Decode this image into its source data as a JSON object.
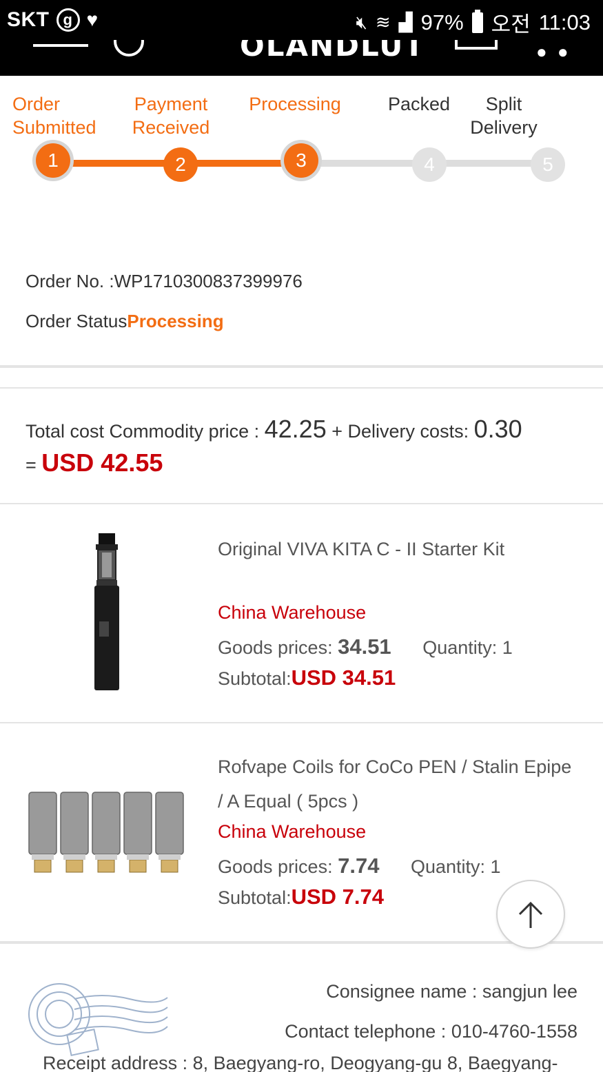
{
  "status_bar": {
    "carrier": "SKT",
    "carrier_badge": "g",
    "battery": "97%",
    "time_prefix": "오전",
    "time": "11:03"
  },
  "header": {
    "brand": "OLANDLUT"
  },
  "progress": {
    "steps": [
      {
        "label_line1": "Order",
        "label_line2": "Submitted",
        "number": "1",
        "state": "done"
      },
      {
        "label_line1": "Payment",
        "label_line2": "Received",
        "number": "2",
        "state": "done"
      },
      {
        "label_line1": "Processing",
        "label_line2": "",
        "number": "3",
        "state": "current"
      },
      {
        "label_line1": "Packed",
        "label_line2": "",
        "number": "4",
        "state": "todo"
      },
      {
        "label_line1": "Split",
        "label_line2": "Delivery",
        "number": "5",
        "state": "todo"
      }
    ],
    "accent_color": "#f36d13"
  },
  "order": {
    "number_label": "Order No. :",
    "number": "WP1710300837399976",
    "status_label": "Order Status",
    "status": "Processing"
  },
  "total": {
    "label": "Total cost Commodity price :",
    "commodity_price": "42.25",
    "plus": "+",
    "delivery_label": "Delivery costs:",
    "delivery_cost": "0.30",
    "equals": "=",
    "grand_total": "USD 42.55",
    "total_color": "#c8000a"
  },
  "items": [
    {
      "title": "Original VIVA KITA C - II Starter Kit",
      "warehouse": "China Warehouse",
      "goods_label": "Goods prices:",
      "goods_price": "34.51",
      "quantity_label": "Quantity:",
      "quantity": "1",
      "subtotal_label": "Subtotal:",
      "subtotal": "USD 34.51",
      "image_icon": "vape-pen-icon"
    },
    {
      "title": "Rofvape Coils for CoCo PEN / Stalin Epipe / A Equal ( 5pcs )",
      "warehouse": "China Warehouse",
      "goods_label": "Goods prices:",
      "goods_price": "7.74",
      "quantity_label": "Quantity:",
      "quantity": "1",
      "subtotal_label": "Subtotal:",
      "subtotal": "USD 7.74",
      "image_icon": "coil-set-icon"
    }
  ],
  "consignee": {
    "name_label": "Consignee name :",
    "name": "sangjun lee",
    "phone_label": "Contact telephone :",
    "phone": "010-4760-1558",
    "address_label": "Receipt address :",
    "address": "8, Baegyang-ro, Deogyang-gu 8, Baegyang-"
  }
}
